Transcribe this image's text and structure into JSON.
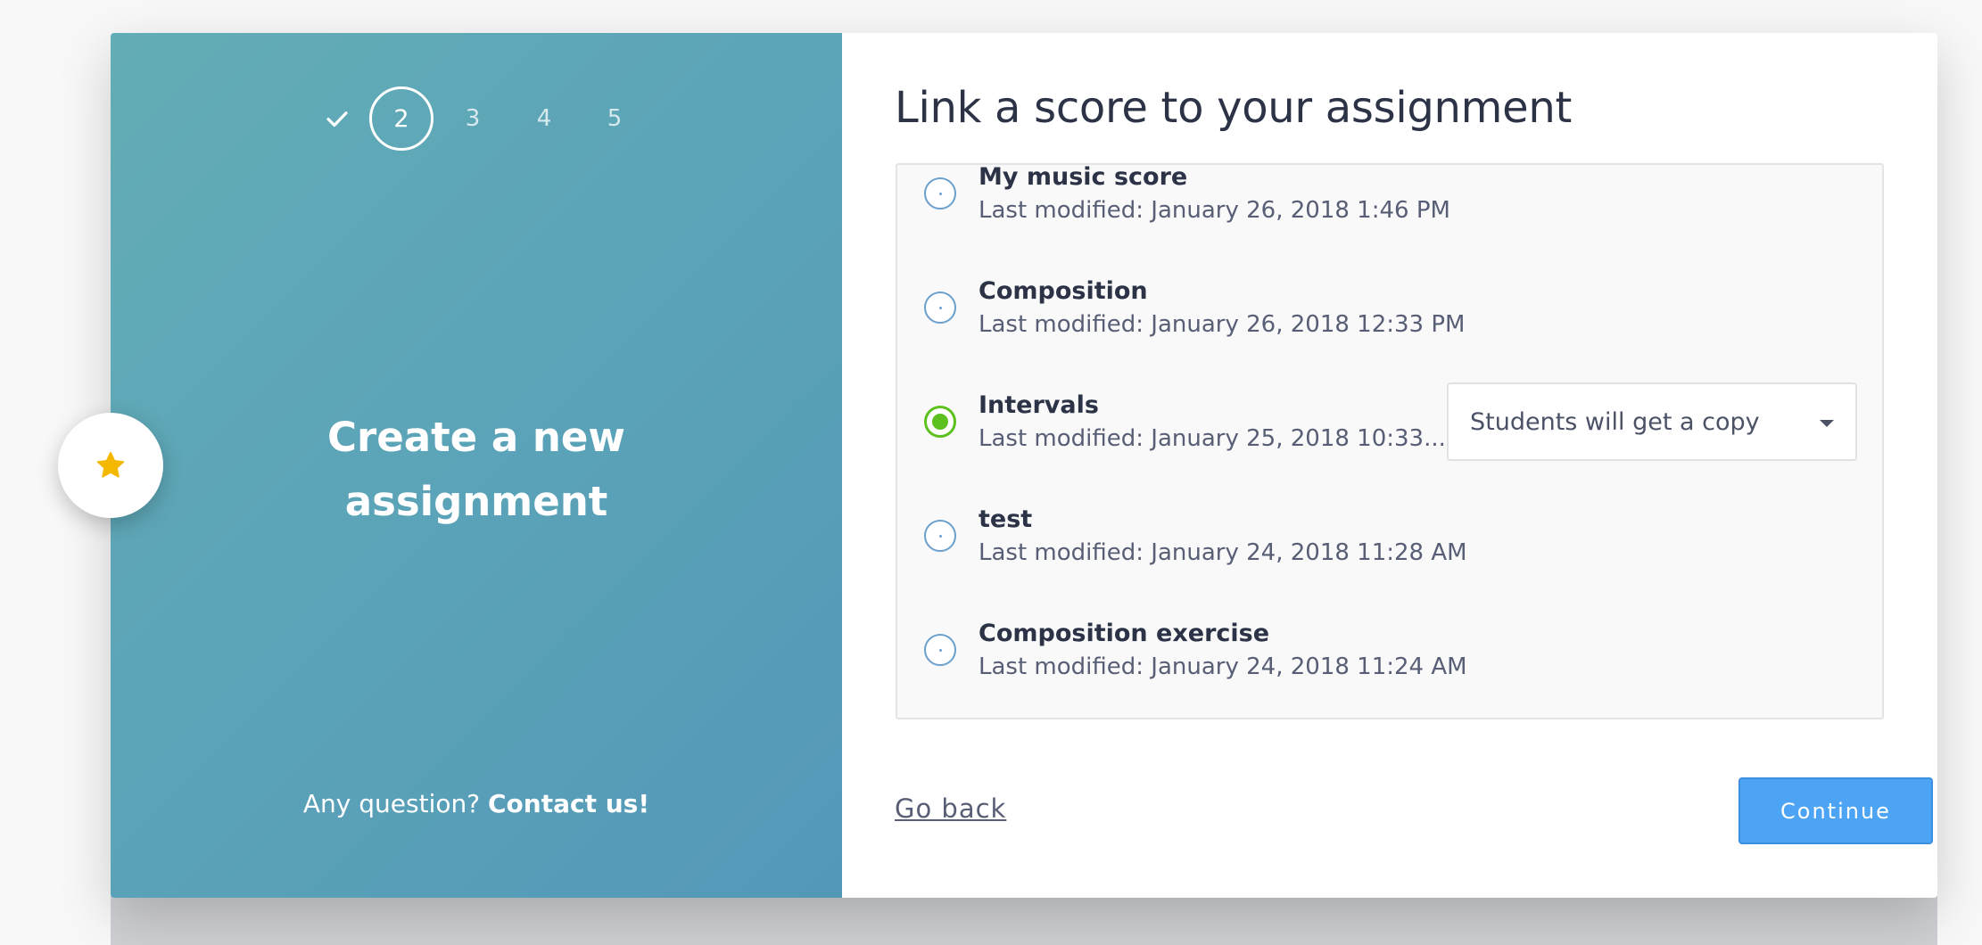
{
  "stepper": {
    "completed_icon": "check-icon",
    "steps": [
      "2",
      "3",
      "4",
      "5"
    ]
  },
  "left_panel": {
    "title_line1": "Create a new",
    "title_line2": "assignment",
    "footer_question": "Any question?",
    "footer_link": "Contact us!"
  },
  "fab": {
    "icon": "star-icon",
    "color": "#f5b800"
  },
  "main": {
    "title": "Link a score to your assignment",
    "scores": [
      {
        "name": "My music score",
        "modified": "Last modified: January 26, 2018 1:46 PM",
        "selected": false
      },
      {
        "name": "Composition",
        "modified": "Last modified: January 26, 2018 12:33 PM",
        "selected": false
      },
      {
        "name": "Intervals",
        "modified": "Last modified: January 25, 2018 10:33...",
        "selected": true
      },
      {
        "name": "test",
        "modified": "Last modified: January 24, 2018 11:28 AM",
        "selected": false
      },
      {
        "name": "Composition exercise",
        "modified": "Last modified: January 24, 2018 11:24 AM",
        "selected": false
      }
    ],
    "copy_select": {
      "value": "Students will get a copy"
    }
  },
  "footer": {
    "go_back": "Go back",
    "continue": "Continue"
  },
  "colors": {
    "panel_gradient_start": "#63adb6",
    "panel_gradient_end": "#5498b8",
    "radio_selected": "#5cc11e",
    "primary_button": "#4ea4f4"
  }
}
